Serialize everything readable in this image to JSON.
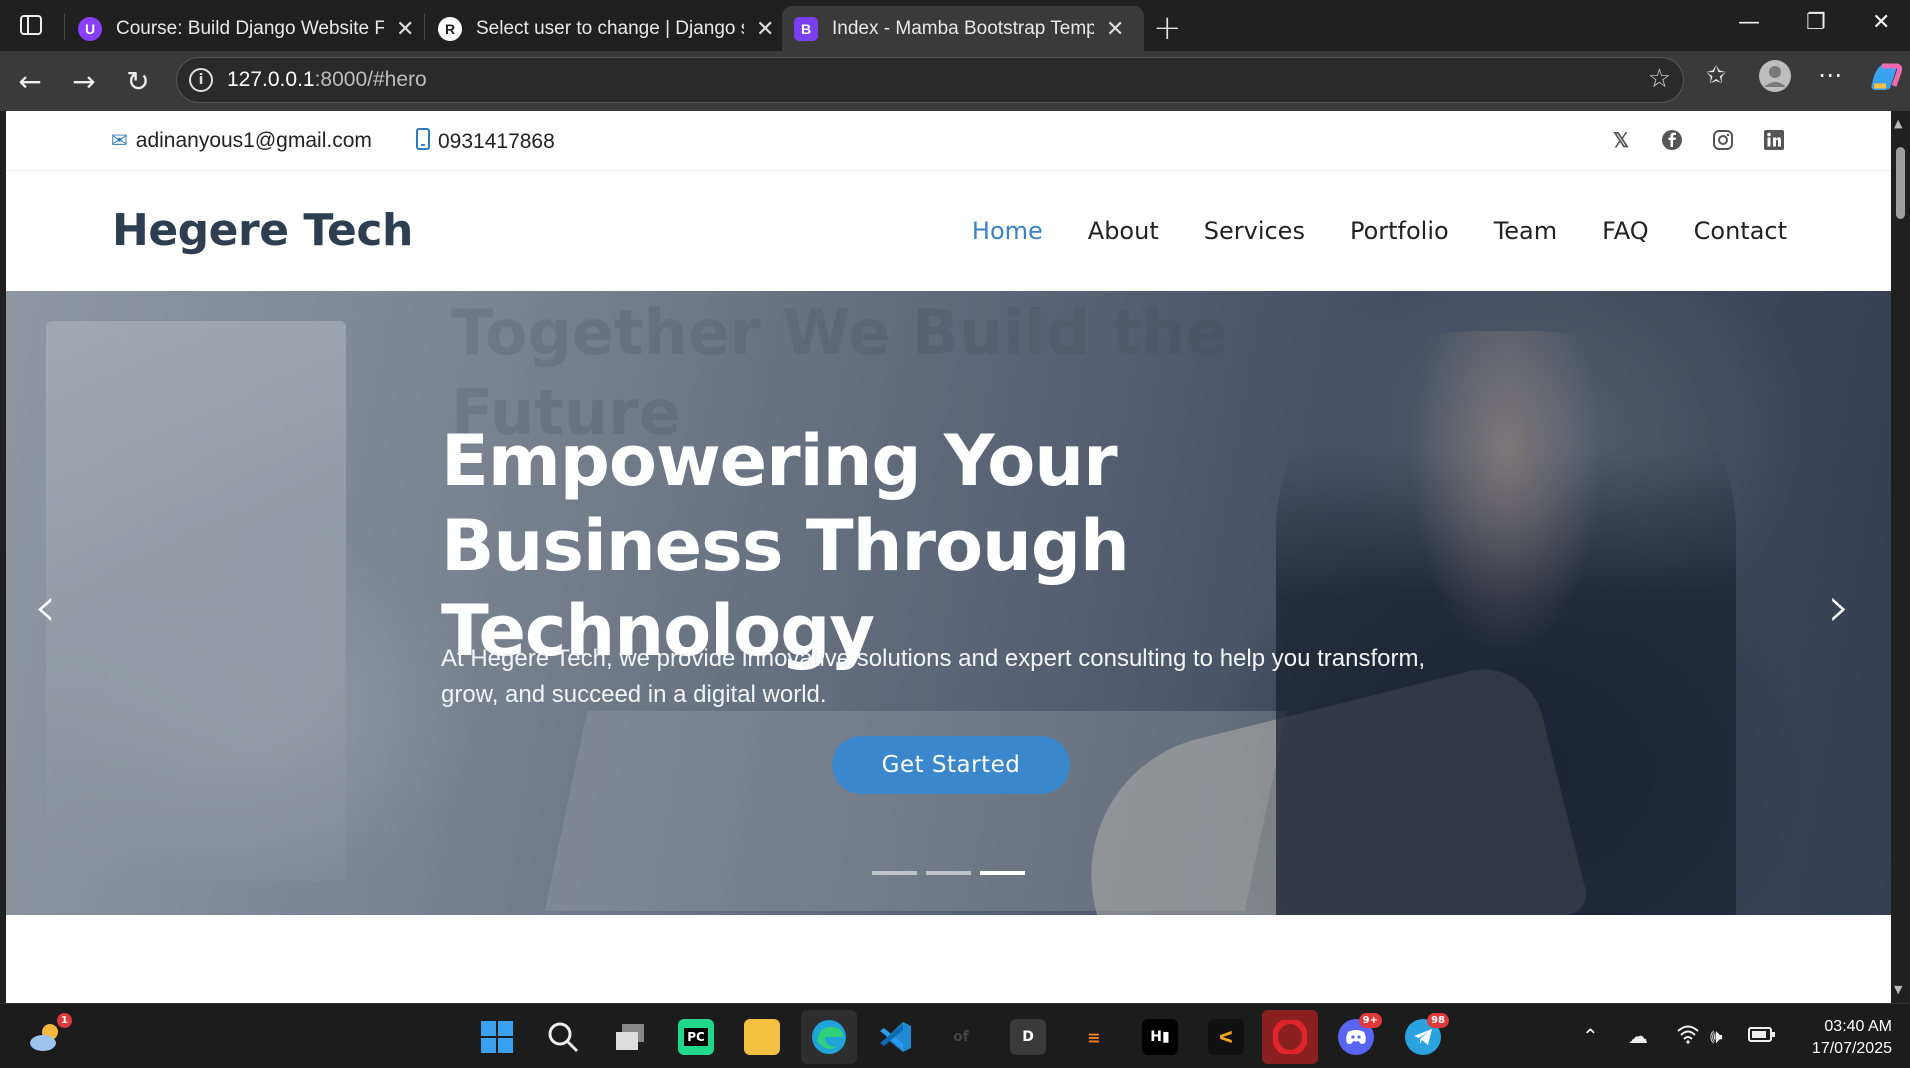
{
  "browser": {
    "tabs": [
      {
        "title": "Course: Build Django Website Fro",
        "favicon": "U",
        "favicon_color": "#8a3ffc"
      },
      {
        "title": "Select user to change | Django sit",
        "favicon": "R",
        "favicon_color": "#ffffff"
      },
      {
        "title": "Index - Mamba Bootstrap Templa",
        "favicon": "B",
        "favicon_color": "#7b3ff2"
      }
    ],
    "url_host": "127.0.0.1",
    "url_rest": ":8000/#hero"
  },
  "site": {
    "topbar": {
      "email": "adinanyous1@gmail.com",
      "phone": "0931417868",
      "social": [
        "twitter-x-icon",
        "facebook-icon",
        "instagram-icon",
        "linkedin-icon"
      ]
    },
    "logo": "Hegere Tech",
    "nav": [
      {
        "label": "Home",
        "active": true
      },
      {
        "label": "About"
      },
      {
        "label": "Services"
      },
      {
        "label": "Portfolio"
      },
      {
        "label": "Team"
      },
      {
        "label": "FAQ"
      },
      {
        "label": "Contact"
      }
    ],
    "hero": {
      "ghost_text": "Together We Build the Future",
      "title": "Empowering Your Business Through Technology",
      "description": "At Hegere Tech, we provide innovative solutions and expert consulting to help you transform, grow, and succeed in a digital world.",
      "cta": "Get Started",
      "slides_total": 3,
      "active_slide": 3
    }
  },
  "taskbar": {
    "weather_badge": "1",
    "discord_badge": "9+",
    "telegram_badge": "98",
    "time": "03:40 AM",
    "date": "17/07/2025"
  },
  "colors": {
    "accent": "#3b82c4",
    "cta": "#3a87cc",
    "logo": "#2c3e50"
  }
}
